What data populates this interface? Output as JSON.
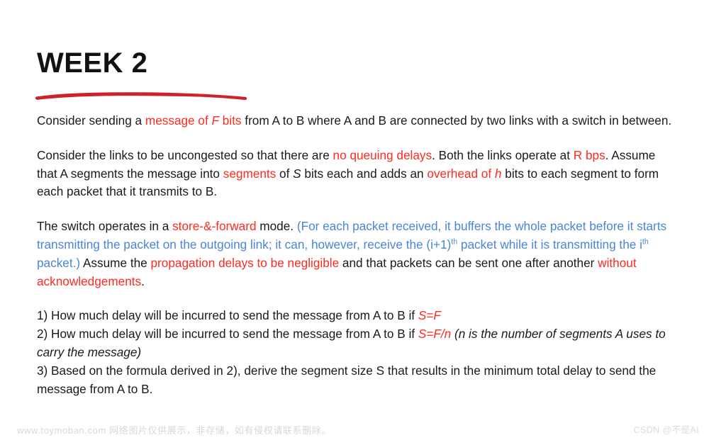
{
  "slide": {
    "title": "WEEK 2",
    "accent_color": "#ff2a20",
    "underline_color": "#cc2229",
    "blue_color": "#4a86d8",
    "text_color": "#1a1a1a",
    "background_color": "#ffffff"
  },
  "paragraph1": {
    "t1": "Consider sending a ",
    "r1": "message of ",
    "r1i": "F",
    "r2": " bits",
    "t2": " from A to B where A and B are connected by two links with a switch in between."
  },
  "paragraph2": {
    "t1": "Consider the links to be uncongested so that there are ",
    "r1": "no queuing delays",
    "t2": ". Both the links operate at ",
    "r2": "R bps",
    "t3": ". Assume that A segments the message into ",
    "r3": "segments",
    "t4": " of ",
    "i1": "S",
    "t5": " bits each and adds an ",
    "r4": "overhead of ",
    "r4i": "h",
    "t6": " bits to each segment to form each packet that it transmits to B."
  },
  "paragraph3": {
    "t1": "The switch operates in a ",
    "r1": "store-&-forward",
    "t2": " mode. ",
    "b1": "(For each packet received, it buffers the whole packet before it starts transmitting the packet on the outgoing link; it can, however, receive the (i+1)",
    "b1sup": "th",
    "b2": " packet while it is transmitting the i",
    "b2sup": "th",
    "b3": " packet.)",
    "t3": " Assume the ",
    "r2": "propagation delays to be negligible",
    "t4": " and that packets can be sent one after another ",
    "r3": "without acknowledgements",
    "t5": "."
  },
  "questions": {
    "q1_t1": "1) How much delay will be incurred to send the message from A to B if ",
    "q1_r1": "S=F",
    "q2_t1": "2) How much delay will be incurred to send the message from A to B if ",
    "q2_r1": "S=F/n",
    "q2_t2": " ",
    "q2_i1": "(n is the number of segments A uses to carry the message)",
    "q3_t1": "3) Based on the formula derived in 2), derive the segment size S that results in the minimum total delay to send the message from A to B."
  },
  "watermarks": {
    "left": "www.toymoban.com 网络图片仅供展示，非存储，如有侵权请联系删除。",
    "right": "CSDN @不是AI"
  }
}
